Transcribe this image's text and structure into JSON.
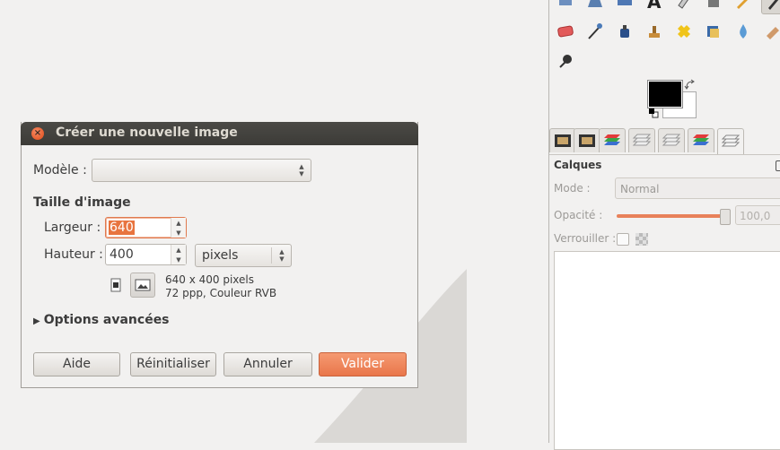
{
  "dialog": {
    "title": "Créer une nouvelle image",
    "modele_label": "Modèle :",
    "modele_value": "",
    "taille_heading": "Taille d'image",
    "largeur_label": "Largeur :",
    "largeur_value": "640",
    "hauteur_label": "Hauteur :",
    "hauteur_value": "400",
    "unit_value": "pixels",
    "info_line1": "640 x 400 pixels",
    "info_line2": "72 ppp, Couleur RVB",
    "advanced_label": "Options avancées",
    "buttons": {
      "aide": "Aide",
      "reinitialiser": "Réinitialiser",
      "annuler": "Annuler",
      "valider": "Valider"
    }
  },
  "dock": {
    "calques_title": "Calques",
    "mode_label": "Mode :",
    "mode_value": "Normal",
    "opacity_label": "Opacité :",
    "opacity_value": "100,0",
    "opacity_fraction": 1.0,
    "lock_label": "Verrouiller :"
  },
  "colors": {
    "accent": "#e8743f",
    "titlebar": "#3c3b37",
    "foreground": "#000000",
    "background": "#ffffff"
  }
}
